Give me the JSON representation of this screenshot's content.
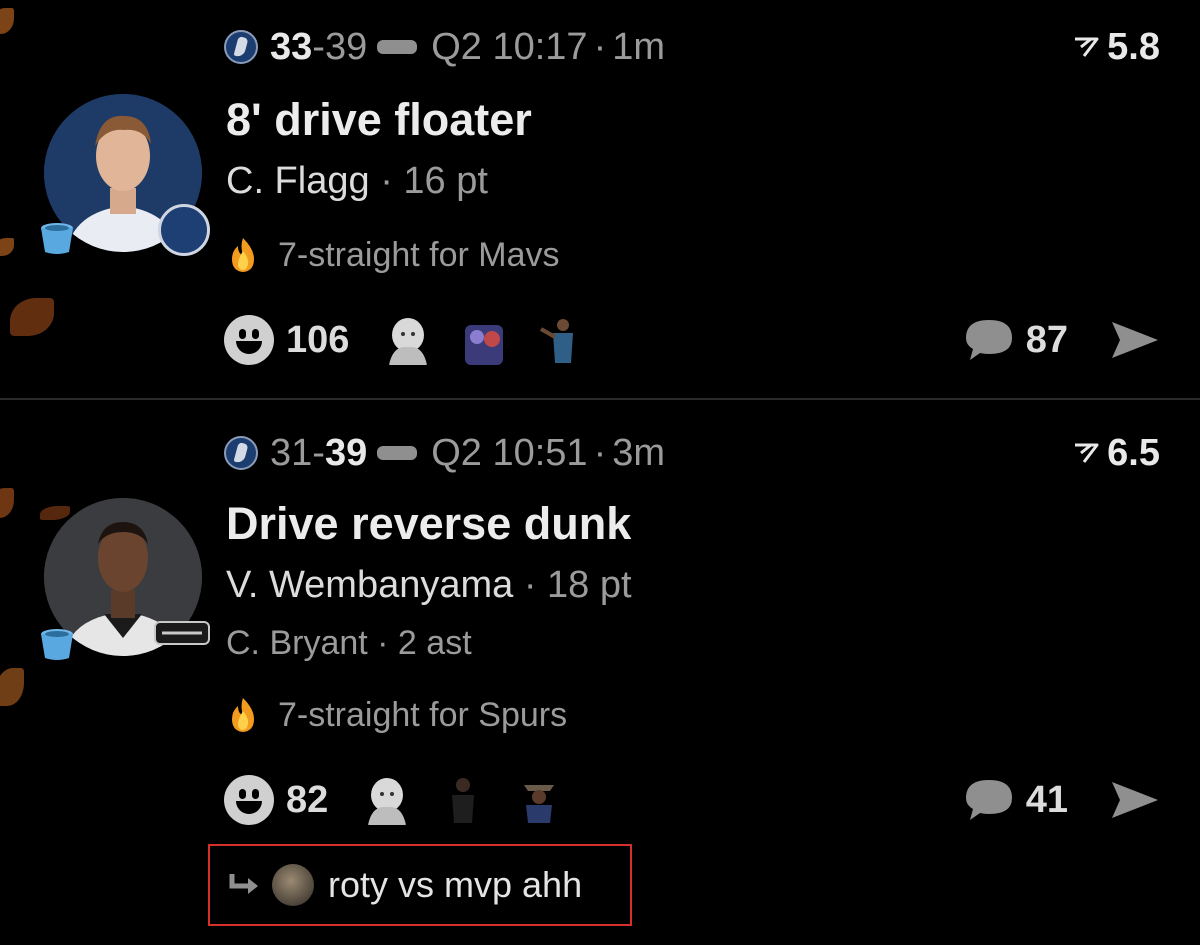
{
  "plays": [
    {
      "home_score": "33",
      "away_score": "39",
      "leading": "home",
      "clock": "Q2 10:17",
      "age": "1m",
      "heat": "5.8",
      "title": "8' drive floater",
      "player": "C. Flagg",
      "points": "16 pt",
      "assist": "",
      "streak": "7-straight for Mavs",
      "reactions": "106",
      "comments": "87",
      "team": "Mavs"
    },
    {
      "home_score": "31",
      "away_score": "39",
      "leading": "away",
      "clock": "Q2 10:51",
      "age": "3m",
      "heat": "6.5",
      "title": "Drive reverse dunk",
      "player": "V. Wembanyama",
      "points": "18 pt",
      "assist": "C. Bryant · 2 ast",
      "streak": "7-straight for Spurs",
      "reactions": "82",
      "comments": "41",
      "team": "Spurs"
    }
  ],
  "separators": {
    "dash": "-",
    "dot": "·"
  },
  "reply": {
    "text": "roty vs mvp ahh"
  },
  "icons": {
    "mavs_logo": "mavs-logo-icon",
    "spurs_logo": "spurs-logo-icon",
    "heat": "heat-index-icon",
    "fire": "fire-icon",
    "bucket": "bucket-icon",
    "reaction": "smiley-icon",
    "comment": "comment-bubble-icon",
    "share": "share-arrow-icon",
    "reply": "reply-arrow-icon"
  },
  "colors": {
    "background": "#000000",
    "muted": "#9b9b9b",
    "highlight_border": "#d6302b",
    "mavs_blue": "#1d3f74"
  }
}
